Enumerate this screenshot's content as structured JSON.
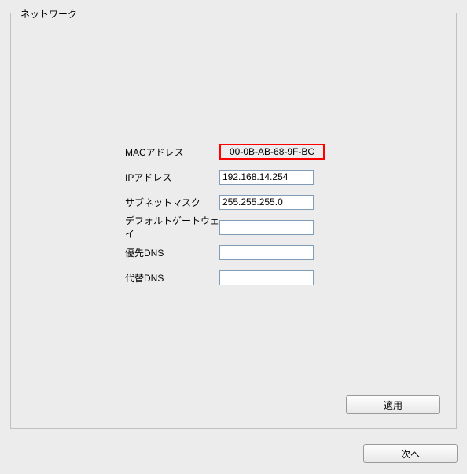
{
  "fieldset": {
    "legend": "ネットワーク"
  },
  "fields": {
    "mac": {
      "label": "MACアドレス",
      "value": "00-0B-AB-68-9F-BC"
    },
    "ip": {
      "label": "IPアドレス",
      "value": "192.168.14.254"
    },
    "subnet": {
      "label": "サブネットマスク",
      "value": "255.255.255.0"
    },
    "gateway": {
      "label": "デフォルトゲートウェイ",
      "value": ""
    },
    "dns1": {
      "label": "優先DNS",
      "value": ""
    },
    "dns2": {
      "label": "代替DNS",
      "value": ""
    }
  },
  "buttons": {
    "apply": "適用",
    "next": "次へ"
  }
}
